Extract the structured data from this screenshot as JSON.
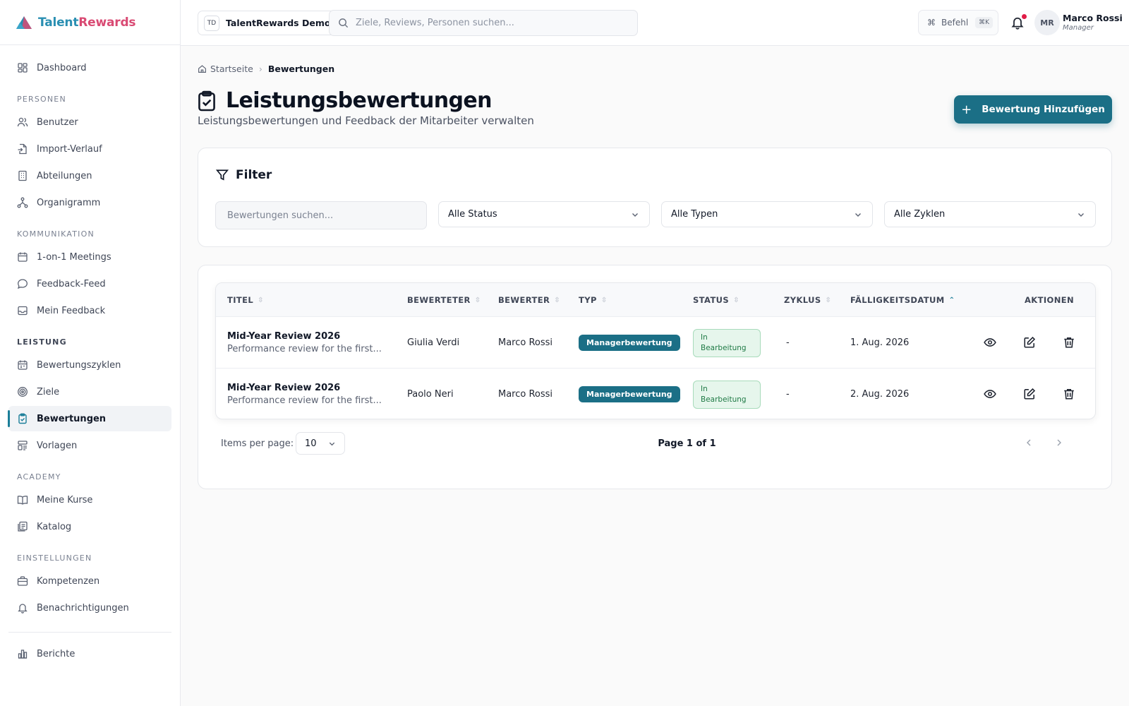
{
  "brand": {
    "name_part1": "Talent",
    "name_part2": "Rewards"
  },
  "sidebar": {
    "dashboard": "Dashboard",
    "sections": {
      "personen": "PERSONEN",
      "kommunikation": "KOMMUNIKATION",
      "leistung": "LEISTUNG",
      "academy": "ACADEMY",
      "einstellungen": "EINSTELLUNGEN"
    },
    "items": {
      "benutzer": "Benutzer",
      "import_verlauf": "Import-Verlauf",
      "abteilungen": "Abteilungen",
      "organigramm": "Organigramm",
      "meetings": "1-on-1 Meetings",
      "feedback_feed": "Feedback-Feed",
      "mein_feedback": "Mein Feedback",
      "bewertungszyklen": "Bewertungszyklen",
      "ziele": "Ziele",
      "bewertungen": "Bewertungen",
      "vorlagen": "Vorlagen",
      "meine_kurse": "Meine Kurse",
      "katalog": "Katalog",
      "kompetenzen": "Kompetenzen",
      "benachrichtigungen": "Benachrichtigungen",
      "berichte": "Berichte"
    },
    "active_item": "Bewertungen"
  },
  "topbar": {
    "org_badge": "TD",
    "org_name": "TalentRewards Demo",
    "search_placeholder": "Ziele, Reviews, Personen suchen...",
    "command_label": "Befehl",
    "command_shortcut": "⌘K",
    "has_notification": true,
    "user_initials": "MR",
    "user_name": "Marco Rossi",
    "user_role": "Manager"
  },
  "breadcrumb": {
    "home": "Startseite",
    "current": "Bewertungen"
  },
  "page": {
    "title": "Leistungsbewertungen",
    "subtitle": "Leistungsbewertungen und Feedback der Mitarbeiter verwalten",
    "add_button": "Bewertung Hinzufügen"
  },
  "filter": {
    "title": "Filter",
    "search_placeholder": "Bewertungen suchen...",
    "status": "Alle Status",
    "types": "Alle Typen",
    "cycles": "Alle Zyklen"
  },
  "table": {
    "headers": {
      "title": "TITEL",
      "reviewee": "BEWERTETER",
      "reviewer": "BEWERTER",
      "type": "TYP",
      "status": "STATUS",
      "cycle": "ZYKLUS",
      "due": "FÄLLIGKEITSDATUM",
      "actions": "AKTIONEN"
    },
    "rows": [
      {
        "title": "Mid-Year Review 2026",
        "description": "Performance review for the first...",
        "reviewee": "Giulia Verdi",
        "reviewer": "Marco Rossi",
        "type": "Managerbewertung",
        "status": "In Bearbeitung",
        "cycle": "-",
        "due": "1. Aug. 2026"
      },
      {
        "title": "Mid-Year Review 2026",
        "description": "Performance review for the first...",
        "reviewee": "Paolo Neri",
        "reviewer": "Marco Rossi",
        "type": "Managerbewertung",
        "status": "In Bearbeitung",
        "cycle": "-",
        "due": "2. Aug. 2026"
      }
    ]
  },
  "pagination": {
    "items_per_page_label": "Items per page:",
    "items_per_page": "10",
    "page_info": "Page 1 of 1"
  },
  "colors": {
    "primary": "#1b6f86",
    "status_bg": "#e6f6ec",
    "status_text": "#1f7a45",
    "brand_teal": "#2a8fb2",
    "brand_pink": "#d94a73"
  }
}
